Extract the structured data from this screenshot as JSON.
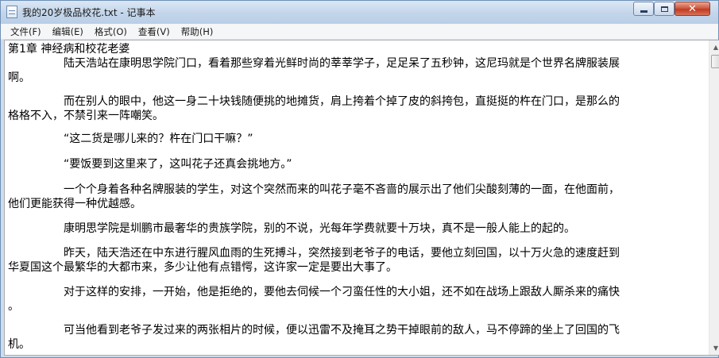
{
  "window": {
    "title": "我的20岁极品校花.txt - 记事本",
    "background_tabs": [
      "            "
    ],
    "controls": {
      "minimize": "",
      "maximize": "",
      "close": "✕"
    }
  },
  "menu": {
    "items": [
      "文件(F)",
      "编辑(E)",
      "格式(O)",
      "查看(V)",
      "帮助(H)"
    ]
  },
  "document": {
    "lines": [
      "第1章 神经病和校花老婆",
      "　　　　　陆天浩站在康明思学院门口，看着那些穿着光鲜时尚的莘莘学子，足足呆了五秒钟，这尼玛就是个世界名牌服装展",
      "啊。",
      "　　　　　而在别人的眼中，他这一身二十块钱随便挑的地摊货，肩上挎着个掉了皮的斜挎包，直挺挺的杵在门口，是那么的",
      "格格不入，不禁引来一阵嘲笑。",
      "　　　　　“这二货是哪儿来的？杵在门口干嘛？”",
      "　　　　　“要饭要到这里来了，这叫花子还真会挑地方。”",
      "　　　　　一个个身着各种名牌服装的学生，对这个突然而来的叫花子毫不吝啬的展示出了他们尖酸刻薄的一面，在他面前，",
      "他们更能获得一种优越感。",
      "　　　　　康明思学院是圳鹏市最奢华的贵族学院，别的不说，光每年学费就要十万块，真不是一般人能上的起的。",
      "　　　　　昨天，陆天浩还在中东进行腥风血雨的生死搏斗，突然接到老爷子的电话，要他立刻回国，以十万火急的速度赶到",
      "华夏国这个最繁华的大都市来，多少让他有点错愕，这许家一定是要出大事了。",
      "　　　　　对于这样的安排，一开始，他是拒绝的，要他去伺候一个刁蛮任性的大小姐，还不如在战场上跟敌人厮杀来的痛快",
      "。",
      "　　　　　可当他看到老爷子发过来的两张相片的时候，便以迅雷不及掩耳之势干掉眼前的敌人，马不停蹄的坐上了回国的飞",
      "机。"
    ]
  }
}
